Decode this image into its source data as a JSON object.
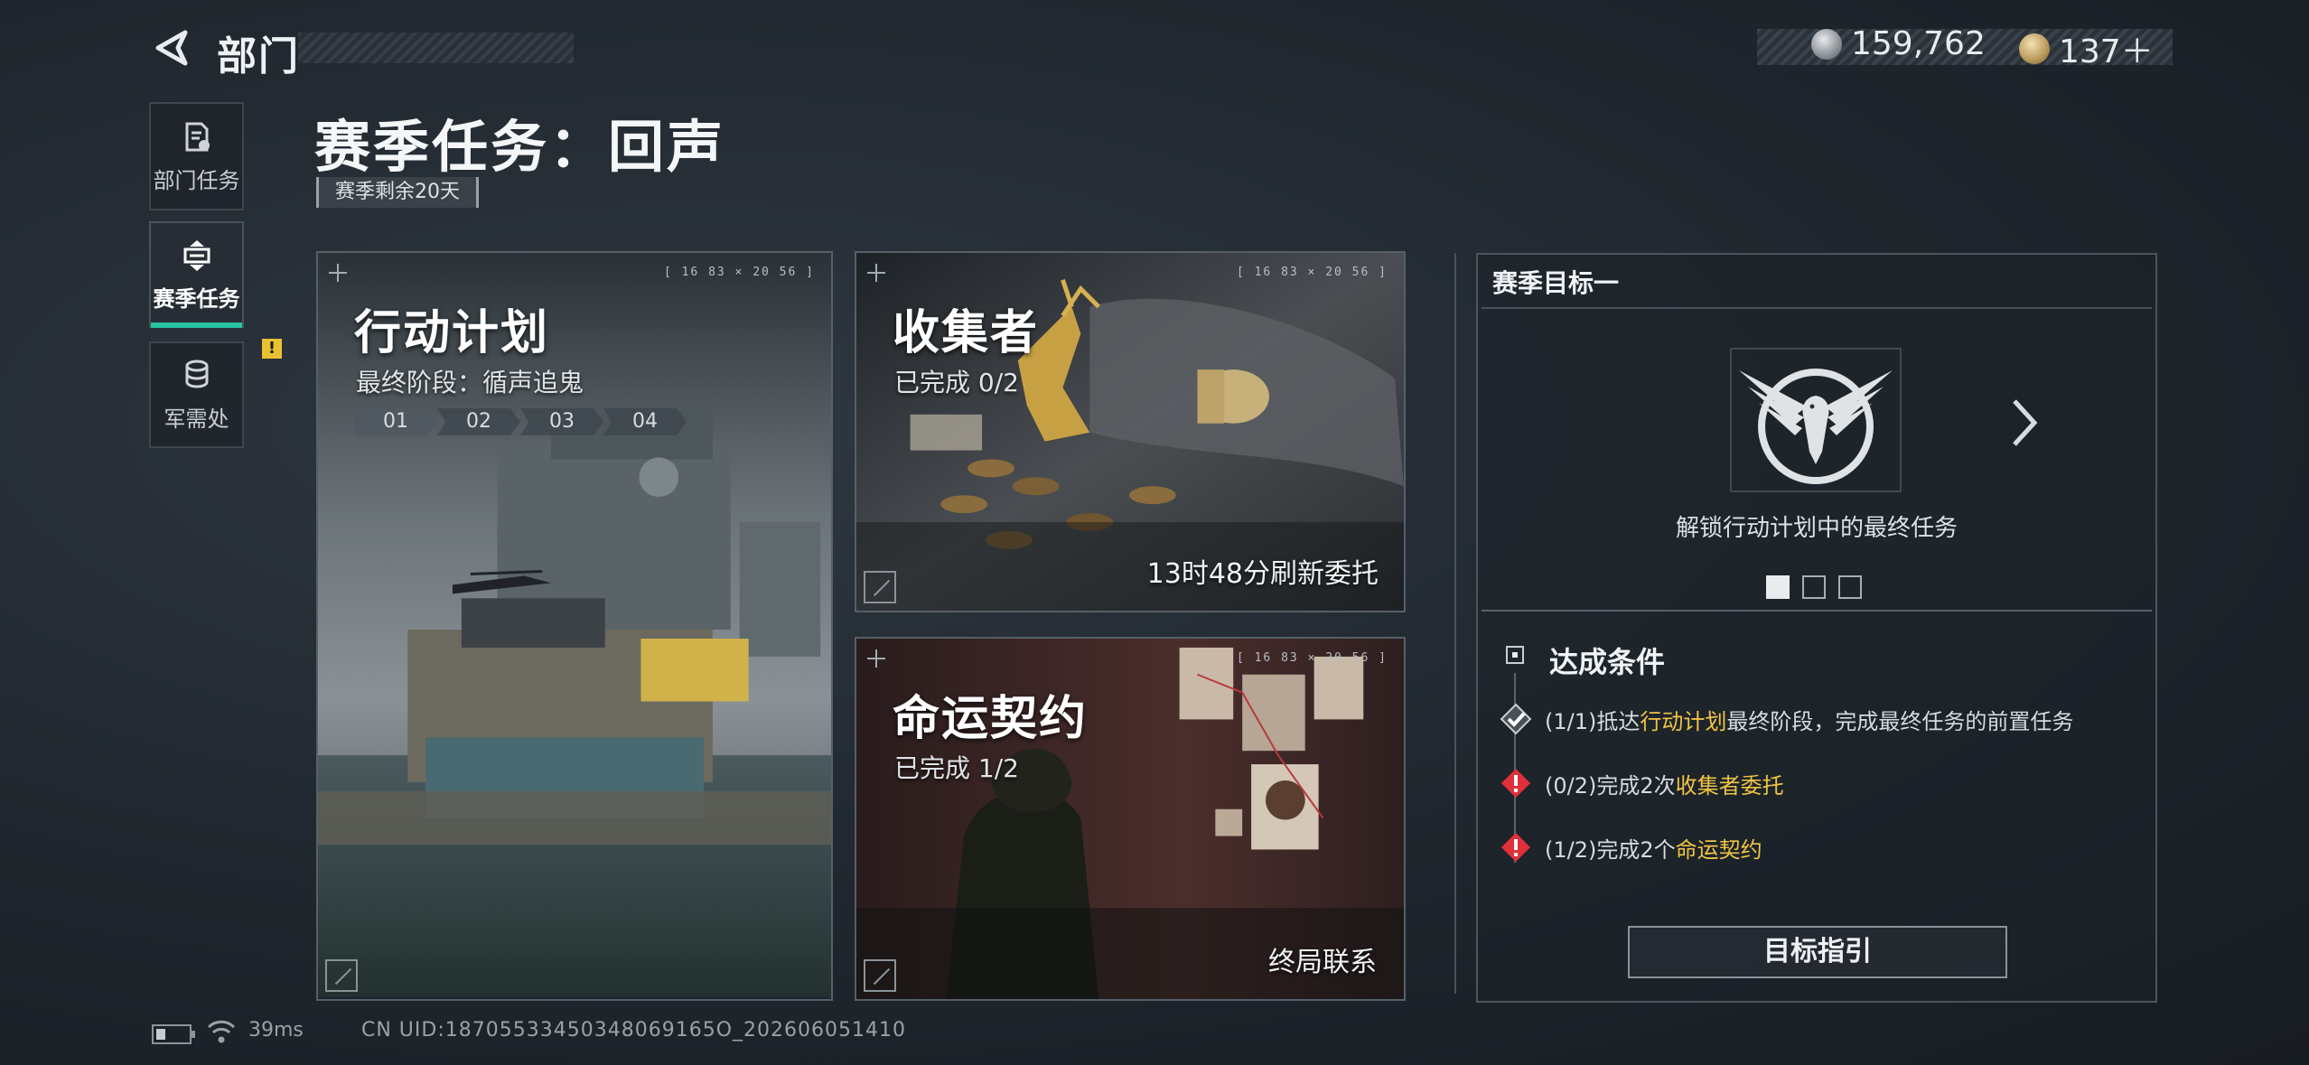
{
  "header": {
    "back_label": "部门",
    "currencies": [
      {
        "icon": "silver-coin-icon",
        "value": "159,762"
      },
      {
        "icon": "gold-coin-icon",
        "value": "137＋"
      }
    ]
  },
  "sidebar": {
    "items": [
      {
        "label": "部门任务",
        "icon": "document-icon",
        "active": false
      },
      {
        "label": "赛季任务",
        "icon": "season-task-icon",
        "active": true
      },
      {
        "label": "军需处",
        "icon": "coin-stack-icon",
        "active": false,
        "alert": "!"
      }
    ]
  },
  "page": {
    "title": "赛季任务：回声",
    "remaining": "赛季剩余20天"
  },
  "cards": {
    "operation": {
      "title": "行动计划",
      "subtitle": "最终阶段：循声追鬼",
      "coord": "[ 16 83 × 20 56 ]",
      "stages": [
        "01",
        "02",
        "03",
        "04"
      ]
    },
    "collector": {
      "title": "收集者",
      "progress": "已完成 0/2",
      "coord": "[ 16 83 × 20 56 ]",
      "refresh": "13时48分刷新委托"
    },
    "destiny": {
      "title": "命运契约",
      "progress": "已完成 1/2",
      "coord": "[ 16 83 × 20 56 ]",
      "footer": "终局联系"
    }
  },
  "goal": {
    "header": "赛季目标一",
    "description": "解锁行动计划中的最终任务",
    "page_count": 3,
    "active_page": 0,
    "conditions_title": "达成条件",
    "conditions": [
      {
        "status": "done",
        "prefix": "(1/1)抵达",
        "highlight": "行动计划",
        "suffix": "最终阶段，完成最终任务的前置任务"
      },
      {
        "status": "pending",
        "prefix": "(0/2)完成2次",
        "highlight": "收集者委托",
        "suffix": ""
      },
      {
        "status": "pending",
        "prefix": "(1/2)完成2个",
        "highlight": "命运契约",
        "suffix": ""
      }
    ],
    "guide_button": "目标指引"
  },
  "footer": {
    "ping": "39ms",
    "uid": "CN UID:18705533450348069165O_202606051410"
  },
  "colors": {
    "accent_green": "#29c2a0",
    "highlight_yellow": "#f0c446",
    "alert_red": "#e0303a"
  }
}
